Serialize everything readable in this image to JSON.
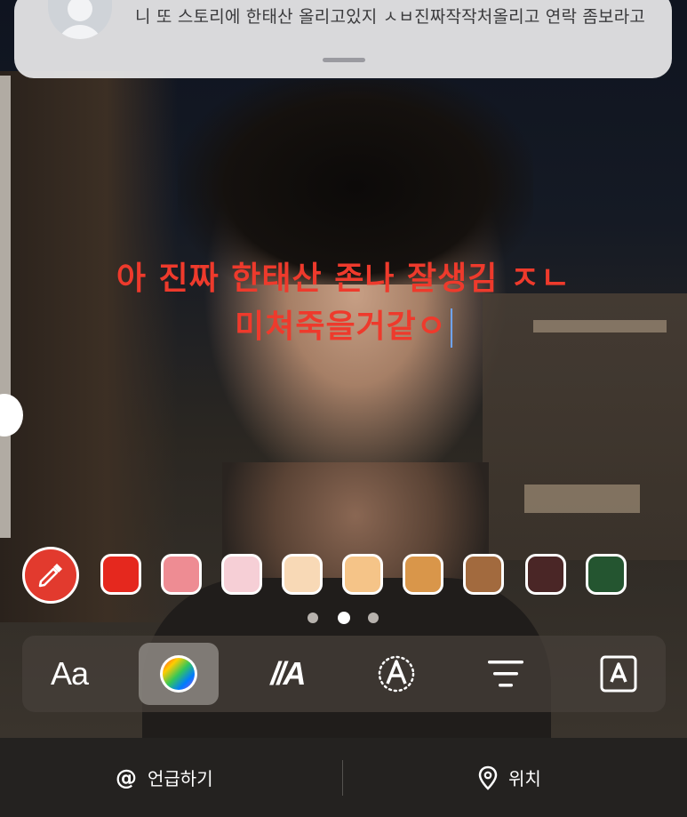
{
  "notification": {
    "message": "니 또 스토리에 한태산 올리고있지 ㅅㅂ진짜작작처올리고 연락 좀보라고"
  },
  "story_text": {
    "line1": "아 진짜  한태산 존나 잘생김 ㅈㄴ",
    "line2": "미쳐죽을거같ㅇ"
  },
  "palette": {
    "eyedropper_icon": "eyedropper-icon",
    "colors": [
      "#e5281e",
      "#ee8c93",
      "#f6cfd6",
      "#f8d9b6",
      "#f5c488",
      "#d9964a",
      "#a26a3e",
      "#4a2626",
      "#245530"
    ],
    "page_dots": 3,
    "active_page": 1
  },
  "toolbar": {
    "font_label": "Aa",
    "animate_label": "//A",
    "selected": "color-wheel"
  },
  "bottom_bar": {
    "mention_icon": "@",
    "mention_label": "언급하기",
    "location_label": "위치"
  }
}
